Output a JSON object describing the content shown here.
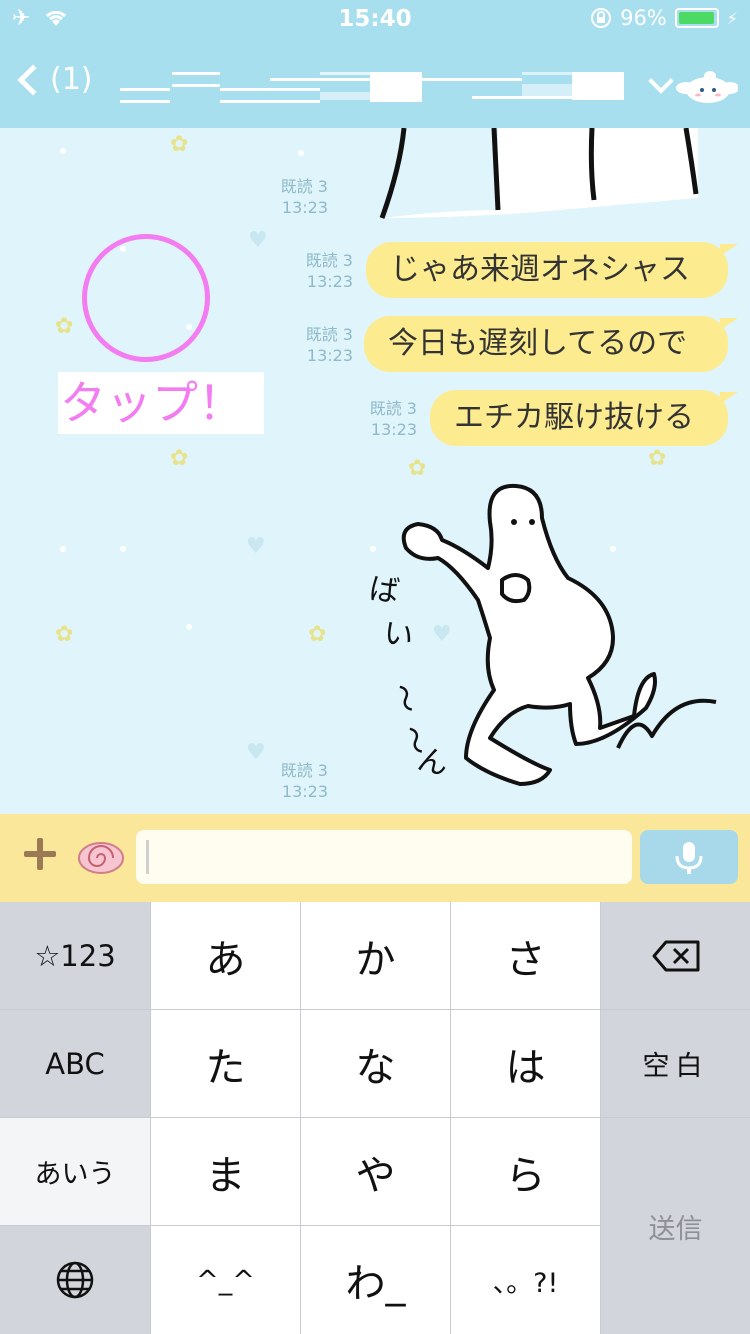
{
  "status_bar": {
    "time": "15:40",
    "battery_text": "96%",
    "battery_level": 0.96,
    "left_icons": [
      "airplane-icon",
      "wifi-icon"
    ],
    "right_icons": [
      "rotation-lock-icon",
      "battery-icon",
      "charging-icon"
    ]
  },
  "header": {
    "back_badge": "(1)",
    "icons": [
      "back-chevron-icon",
      "dropdown-chevron-icon",
      "cinnamoroll-icon"
    ]
  },
  "chat": {
    "messages": [
      {
        "read": "既読 3",
        "time": "13:23",
        "kind": "sticker-fragment"
      },
      {
        "read": "既読 3",
        "time": "13:23",
        "text": "じゃあ来週オネシャス"
      },
      {
        "read": "既読 3",
        "time": "13:23",
        "text": "今日も遅刻してるので"
      },
      {
        "read": "既読 3",
        "time": "13:23",
        "text": "エチカ駆け抜ける"
      },
      {
        "read": "既読 3",
        "time": "13:23",
        "kind": "sticker",
        "sticker_text": "ばい〜〜ん"
      }
    ],
    "tap_label": "タップ！"
  },
  "input_bar": {
    "icons": [
      "plus-icon",
      "cinnamon-roll-icon",
      "microphone-icon"
    ]
  },
  "keyboard": {
    "rows": [
      [
        "☆123",
        "あ",
        "か",
        "さ",
        "⌫"
      ],
      [
        "ABC",
        "た",
        "な",
        "は",
        "空白"
      ],
      [
        "あいう",
        "ま",
        "や",
        "ら",
        "送信"
      ],
      [
        "🌐",
        "^_^",
        "わ_",
        "、。?!"
      ]
    ]
  },
  "colors": {
    "header": "#a8dfee",
    "chat_background": "#dff4fb",
    "bubble": "#fceb8f",
    "input_bar": "#fbe79a",
    "tap_accent": "#f27cf0"
  }
}
